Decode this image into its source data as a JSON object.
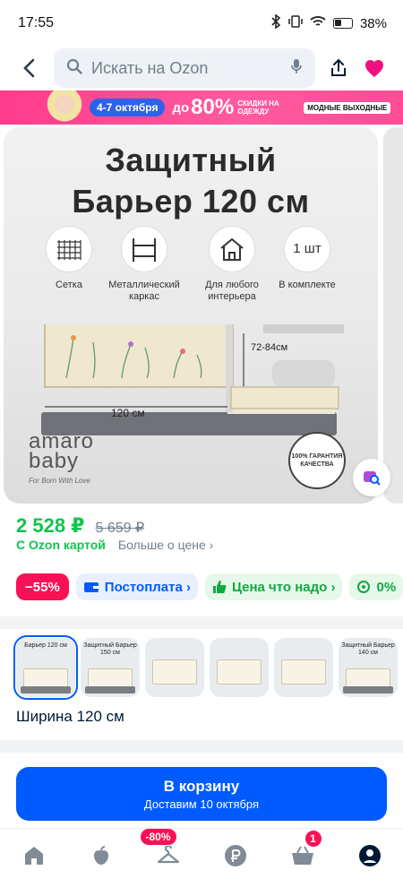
{
  "status_bar": {
    "time": "17:55",
    "battery": "38"
  },
  "search": {
    "placeholder": "Искать на Ozon"
  },
  "promo": {
    "date": "4-7 октября",
    "prefix": "до",
    "percent": "80%",
    "subtitle": "СКИДКИ НА ОДЕЖДУ",
    "badge": "МОДНЫЕ ВЫХОДНЫЕ"
  },
  "image": {
    "title_line1": "Защитный",
    "title_line2": "Барьер 120 см",
    "features": [
      {
        "icon": "mesh-icon",
        "label": "Сетка"
      },
      {
        "icon": "frame-icon",
        "label": "Металлический каркас"
      },
      {
        "icon": "house-icon",
        "label": "Для любого интерьера"
      },
      {
        "icon": "count-icon",
        "icon_text": "1 шт",
        "label": "В комплекте"
      }
    ],
    "dim_width": "120 см",
    "dim_height": "72-84см",
    "brand_top": "amaro",
    "brand_bottom": "baby",
    "brand_tagline": "For Born With Love",
    "guarantee": "100% ГАРАНТИЯ КАЧЕСТВА"
  },
  "price": {
    "current": "2 528 ₽",
    "old": "5 659 ₽",
    "card_label": "С Ozon картой",
    "more_label": "Больше о цене ›"
  },
  "chips": {
    "discount": "−55%",
    "postpay": "Постоплата ›",
    "good_price": "Цена что надо ›",
    "zero": "0%"
  },
  "variants": [
    {
      "title": "Барьер 120 см",
      "selected": true
    },
    {
      "title": "Защитный Барьер 150 см",
      "selected": false
    },
    {
      "title": "",
      "selected": false
    },
    {
      "title": "",
      "selected": false
    },
    {
      "title": "",
      "selected": false
    },
    {
      "title": "Защитный Барьер 140 см",
      "selected": false
    }
  ],
  "width_label": "Ширина 120 см",
  "cart": {
    "label": "В корзину",
    "delivery": "Доставим 10 октября"
  },
  "nav": {
    "promo_badge": "-80%",
    "cart_count": "1"
  },
  "colors": {
    "ozon_blue": "#005bff",
    "price_green": "#10c44c",
    "sale_red": "#f91155",
    "favorite_pink": "#f1117e"
  }
}
